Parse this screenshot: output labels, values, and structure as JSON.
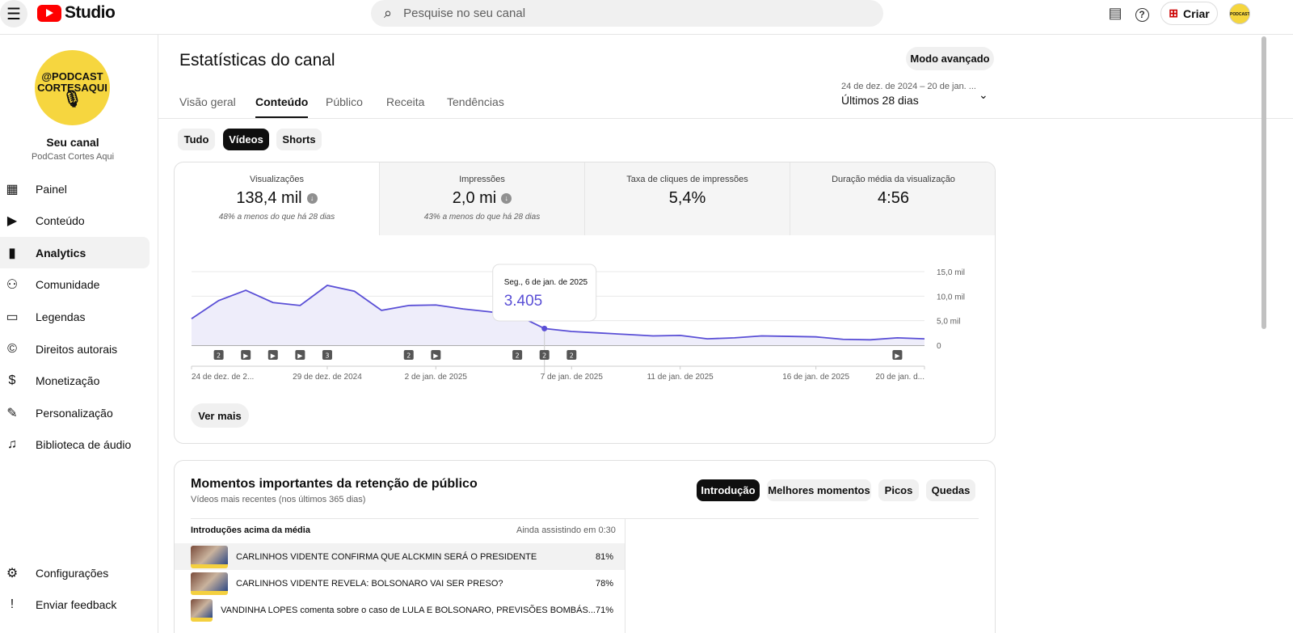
{
  "topbar": {
    "logo": "Studio",
    "search_placeholder": "Pesquise no seu canal",
    "create": "Criar",
    "avatar_text": "PODCAST CORTESAQUI"
  },
  "sidebar": {
    "avatar_line1": "@PODCAST",
    "avatar_line2": "CORTESAQUI",
    "channel_title": "Seu canal",
    "channel_name": "PodCast Cortes Aqui",
    "items": [
      {
        "label": "Painel",
        "icon": "dashboard-icon"
      },
      {
        "label": "Conteúdo",
        "icon": "content-icon"
      },
      {
        "label": "Analytics",
        "icon": "analytics-icon"
      },
      {
        "label": "Comunidade",
        "icon": "community-icon"
      },
      {
        "label": "Legendas",
        "icon": "subtitles-icon"
      },
      {
        "label": "Direitos autorais",
        "icon": "copyright-icon"
      },
      {
        "label": "Monetização",
        "icon": "money-icon"
      },
      {
        "label": "Personalização",
        "icon": "wand-icon"
      },
      {
        "label": "Biblioteca de áudio",
        "icon": "audio-library-icon"
      }
    ],
    "bottom": [
      {
        "label": "Configurações"
      },
      {
        "label": "Enviar feedback"
      }
    ]
  },
  "header": {
    "title": "Estatísticas do canal",
    "advanced": "Modo avançado",
    "tabs": [
      "Visão geral",
      "Conteúdo",
      "Público",
      "Receita",
      "Tendências"
    ],
    "active_tab": 1,
    "date_range": "24 de dez. de 2024 – 20 de jan. ...",
    "period": "Últimos 28 dias"
  },
  "filters": [
    "Tudo",
    "Vídeos",
    "Shorts"
  ],
  "stats": [
    {
      "label": "Visualizações",
      "value": "138,4 mil",
      "compare": "48% a menos do que há 28 dias"
    },
    {
      "label": "Impressões",
      "value": "2,0 mi",
      "compare": "43% a menos do que há 28 dias"
    },
    {
      "label": "Taxa de cliques de impressões",
      "value": "5,4%"
    },
    {
      "label": "Duração média da visualização",
      "value": "4:56"
    }
  ],
  "chart_data": {
    "type": "area",
    "series_name": "Visualizações",
    "x": [
      "24/12",
      "25/12",
      "26/12",
      "27/12",
      "28/12",
      "29/12",
      "30/12",
      "31/12",
      "1/1",
      "2/1",
      "3/1",
      "4/1",
      "5/1",
      "6/1",
      "7/1",
      "8/1",
      "9/1",
      "10/1",
      "11/1",
      "12/1",
      "13/1",
      "14/1",
      "15/1",
      "16/1",
      "17/1",
      "18/1",
      "19/1",
      "20/1"
    ],
    "values": [
      5400,
      9100,
      11200,
      8700,
      8100,
      12200,
      11000,
      7100,
      8100,
      8200,
      7400,
      6800,
      6100,
      3405,
      2800,
      2500,
      2200,
      1900,
      2000,
      1300,
      1500,
      1900,
      1800,
      1700,
      1200,
      1100,
      1500,
      1300
    ],
    "ylim": [
      0,
      15000
    ],
    "yticks": [
      "0",
      "5,0 mil",
      "10,0 mil",
      "15,0 mil"
    ],
    "xticks": [
      {
        "i": 0,
        "label": "24 de dez. de 2..."
      },
      {
        "i": 5,
        "label": "29 de dez. de 2024"
      },
      {
        "i": 9,
        "label": "2 de jan. de 2025"
      },
      {
        "i": 14,
        "label": "7 de jan. de 2025"
      },
      {
        "i": 18,
        "label": "11 de jan. de 2025"
      },
      {
        "i": 23,
        "label": "16 de jan. de 2025"
      },
      {
        "i": 27,
        "label": "20 de jan. d..."
      }
    ],
    "markers": [
      {
        "i": 1,
        "label": "2"
      },
      {
        "i": 2,
        "label": "▶"
      },
      {
        "i": 3,
        "label": "▶"
      },
      {
        "i": 4,
        "label": "▶"
      },
      {
        "i": 5,
        "label": "3"
      },
      {
        "i": 8,
        "label": "2"
      },
      {
        "i": 9,
        "label": "▶"
      },
      {
        "i": 12,
        "label": "2"
      },
      {
        "i": 13,
        "label": "2"
      },
      {
        "i": 14,
        "label": "2"
      },
      {
        "i": 26,
        "label": "▶"
      }
    ],
    "tooltip": {
      "i": 13,
      "date": "Seg., 6 de jan. de 2025",
      "value": "3.405"
    },
    "color": "#5a4fd6"
  },
  "more": "Ver mais",
  "retention": {
    "title": "Momentos importantes da retenção de público",
    "subtitle": "Vídeos mais recentes (nos últimos 365 dias)",
    "tabs": [
      "Introdução",
      "Melhores momentos",
      "Picos",
      "Quedas"
    ],
    "list_title": "Introduções acima da média",
    "list_metric": "Ainda assistindo em 0:30",
    "rows": [
      {
        "title": "CARLINHOS VIDENTE CONFIRMA QUE ALCKMIN SERÁ O PRESIDENTE",
        "pct": "81%"
      },
      {
        "title": "CARLINHOS VIDENTE REVELA: BOLSONARO VAI SER PRESO?",
        "pct": "78%"
      },
      {
        "title": "VANDINHA LOPES comenta sobre o caso de LULA E BOLSONARO, PREVISÕES BOMBÁS...",
        "pct": "71%"
      }
    ]
  }
}
